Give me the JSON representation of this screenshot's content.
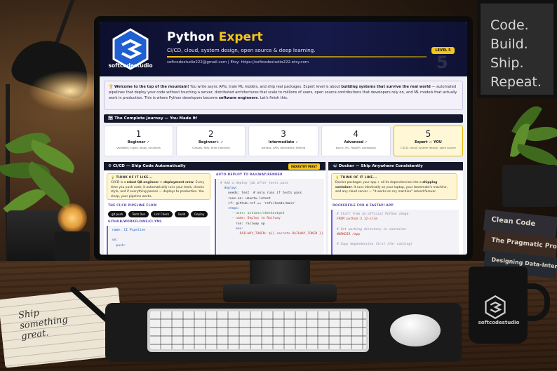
{
  "poster": {
    "lines": [
      "Code.",
      "Build.",
      "Ship.",
      "Repeat."
    ]
  },
  "books": [
    "Clean Code",
    "The Pragmatic Programmer",
    "Designing Data-Intensive Applications"
  ],
  "notebook": {
    "text": [
      "Ship",
      "something",
      "great."
    ]
  },
  "mug": {
    "brand": "softcodestudio"
  },
  "header": {
    "brand": "softcodestudio",
    "title_main": "Python ",
    "title_accent": "Expert",
    "subtitle": "CI/CD, cloud, system design, open source & deep learning.",
    "contact": "softcodestudio222@gmail.com  |  Etsy: https://softcodestudio222.etsy.com",
    "level_badge": "LEVEL 5",
    "level_number": "5"
  },
  "intro": {
    "lead": "Welcome to the top of the mountain!",
    "text1": " You write async APIs, train ML models, and ship real packages. Expert level is about ",
    "bold1": "building systems that survive the real world",
    "text2": " — automated pipelines that deploy your code without touching a server, distributed architectures that scale to millions of users, open source contributions that developers rely on, and ML models that actually work in production. This is where Python developers become ",
    "bold2": "software engineers",
    "text3": ". Let's finish this."
  },
  "journey": {
    "title": "The Complete Journey — You Made It!",
    "steps": [
      {
        "num": "1",
        "name": "Beginner ✓",
        "desc": "Variables, types, loops, functions"
      },
      {
        "num": "2",
        "name": "Beginner+ ✓",
        "desc": "Classes, files, error handling"
      },
      {
        "num": "3",
        "name": "Intermediate ✓",
        "desc": "pandas, APIs, decorators, testing"
      },
      {
        "num": "4",
        "name": "Advanced ✓",
        "desc": "async, ML, FastAPI, packaging"
      },
      {
        "num": "5",
        "name": "Expert — YOU",
        "desc": "CI/CD, cloud, system design, open source"
      }
    ]
  },
  "cicd": {
    "title": "CI/CD — Ship Code Automatically",
    "badge": "INDUSTRY MUST",
    "think_title": "THINK OF IT LIKE...",
    "think_lead": "CI/CD is a ",
    "think_bold": "robot QA engineer + deployment crew",
    "think_rest": ". Every time you push code, it automatically runs your tests, checks style, and if everything passes — deploys to production. You sleep, your pipeline works.",
    "flow_title": "THE CI/CD PIPELINE FLOW",
    "flow": [
      "git push",
      "Tests Run",
      "Lint Check",
      "Build",
      "Deploy"
    ],
    "file_title": "GITHUB/WORKFLOWS/CI.YML",
    "file_lines": [
      "name: CI Pipeline",
      "",
      "on:",
      "  push:"
    ],
    "deploy_title": "AUTO-DEPLOY TO RAILWAY/RENDER",
    "deploy_lines": [
      "# Add a deploy job after tests pass",
      "  deploy:",
      "    needs: test  # only runs if tests pass",
      "    runs-on: ubuntu-latest",
      "    if: github.ref == 'refs/heads/main'",
      "    steps:",
      "      - uses: actions/checkout@v4",
      "      - name: Deploy to Railway",
      "        run: railway up",
      "        env:",
      "          RAILWAY_TOKEN: ${{ secrets.RAILWAY_TOKEN }}"
    ]
  },
  "docker": {
    "title": "Docker — Ship Anywhere Consistently",
    "think_title": "THINK OF IT LIKE...",
    "think_lead": "Docker packages your app + all its dependencies into a ",
    "think_bold": "shipping container",
    "think_rest": ". It runs identically on your laptop, your teammate's machine, and any cloud server — \"it works on my machine\" solved forever.",
    "file_title": "DOCKERFILE FOR A FASTAPI APP",
    "file_lines": [
      "# Start from an official Python image",
      "FROM python:3.12-slim",
      "",
      "# Set working directory in container",
      "WORKDIR /app",
      "",
      "# Copy dependencies first (for caching)"
    ]
  }
}
